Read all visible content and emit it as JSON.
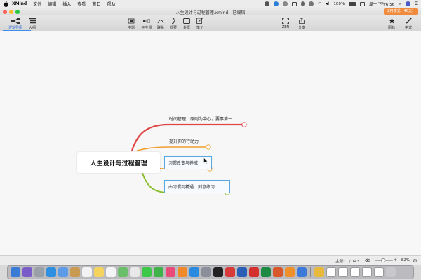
{
  "menubar": {
    "app_name": "XMind",
    "items": [
      "文件",
      "编辑",
      "插入",
      "查看",
      "窗口",
      "帮助"
    ],
    "battery": "100%",
    "clock": "周一 下午6:56"
  },
  "window": {
    "title": "人生设计与过程管理.xmind - 已编辑",
    "trial_button": "试用模式（46天）"
  },
  "toolbar": {
    "view_tabs": [
      {
        "label": "逻辑导图",
        "icon": "mindmap-icon"
      },
      {
        "label": "大纲",
        "icon": "outline-icon"
      }
    ],
    "tools": [
      {
        "label": "主题",
        "icon": "topic-icon"
      },
      {
        "label": "子主题",
        "icon": "subtopic-icon"
      },
      {
        "label": "联系",
        "icon": "relationship-icon"
      },
      {
        "label": "概要",
        "icon": "summary-icon"
      },
      {
        "label": "外框",
        "icon": "boundary-icon"
      },
      {
        "label": "笔记",
        "icon": "notes-icon"
      }
    ],
    "zen": "ZEN",
    "share": "分享",
    "icons_panel": "图标",
    "format_panel": "格式"
  },
  "mindmap": {
    "central_topic": "人生设计与过程管理",
    "branches": [
      {
        "label": "时间管理：原则为中心，要事第一",
        "color": "#e04848",
        "boxed": false
      },
      {
        "label": "提升你的行动力",
        "color": "#f0a030",
        "boxed": false
      },
      {
        "label": "习惯改变与养成",
        "color": "#f0a030",
        "boxed": true
      },
      {
        "label": "由习惯到精通：刻意练习",
        "color": "#8bbf30",
        "boxed": true
      }
    ]
  },
  "statusbar": {
    "topic_count": "主题: 1 / 143",
    "zoom": "82%"
  },
  "colors": {
    "accent": "#3b8be8",
    "trial": "#f08a3c"
  },
  "dock": {
    "apps": [
      "finder-icon",
      "siri-icon",
      "launchpad-icon",
      "safari-icon",
      "mail-icon",
      "contacts-icon",
      "calendar-icon",
      "notes-app-icon",
      "reminders-icon",
      "maps-icon",
      "photos-icon",
      "messages-icon",
      "facetime-icon",
      "itunes-icon",
      "ibooks-icon",
      "appstore-icon",
      "preferences-icon",
      "terminal-icon",
      "xmind-dock-icon",
      "word-icon",
      "pdf-icon",
      "excel-icon",
      "ppt-icon",
      "pages-icon",
      "keynote-icon",
      "chrome-icon",
      "doc-thumb-icon",
      "doc-thumb-icon",
      "doc-thumb-icon",
      "doc-thumb-icon",
      "doc-thumb-icon",
      "trash-icon"
    ]
  }
}
